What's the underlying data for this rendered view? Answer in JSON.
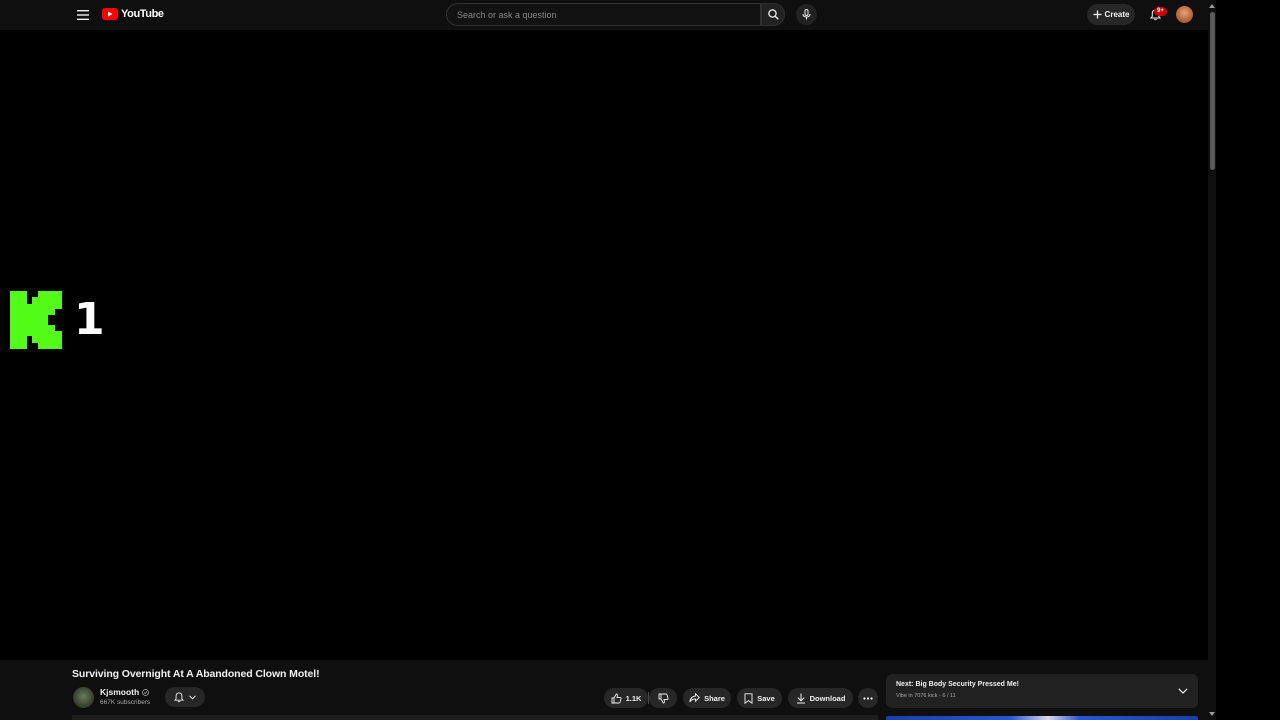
{
  "header": {
    "logo_text": "YouTube",
    "search_placeholder": "Search or ask a question",
    "create_label": "Create",
    "notification_count": "9+"
  },
  "player": {
    "overlay_number": "1"
  },
  "video": {
    "title": "Surviving Overnight At A Abandoned Clown Motel!",
    "channel_name": "Kjsmooth",
    "subscribers": "667K subscribers",
    "likes": "1.1K",
    "share_label": "Share",
    "save_label": "Save",
    "download_label": "Download"
  },
  "playlist": {
    "next_title": "Next: Big Body Security Pressed Me!",
    "next_subtitle": "Vibe in 7076 kick - 6 / 11"
  },
  "colors": {
    "background": "#0f0f0f",
    "player": "#000000",
    "brand_red": "#ff0000",
    "kick_green": "#53fc18",
    "pill_bg": "#272727"
  },
  "icons": [
    "menu-icon",
    "youtube-logo-icon",
    "search-icon",
    "mic-icon",
    "plus-icon",
    "bell-icon",
    "verified-icon",
    "chevron-down-icon",
    "thumbs-up-icon",
    "thumbs-down-icon",
    "share-icon",
    "bookmark-icon",
    "download-icon",
    "more-icon",
    "kick-logo-icon"
  ]
}
